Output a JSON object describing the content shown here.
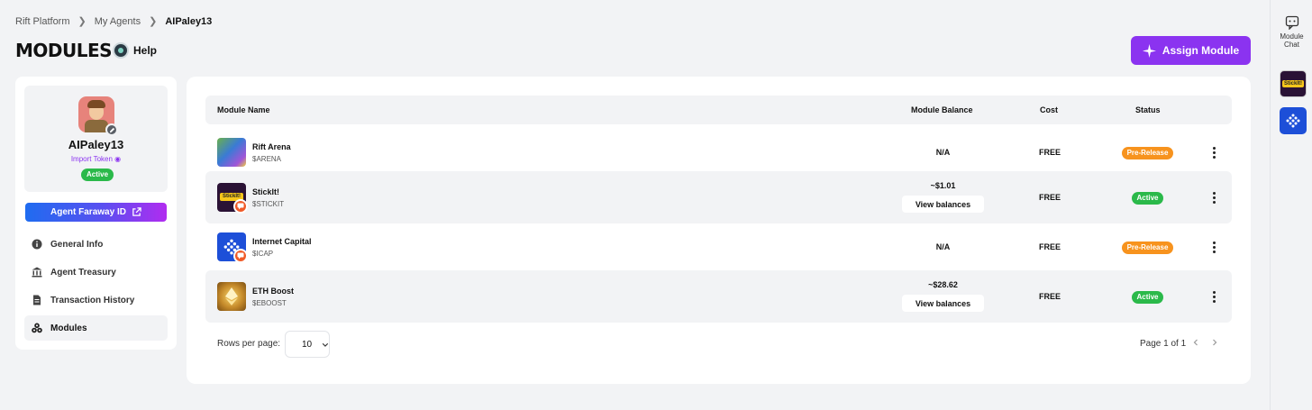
{
  "breadcrumb": {
    "items": [
      "Rift Platform",
      "My Agents"
    ],
    "current": "AIPaley13"
  },
  "page": {
    "title": "MODULES",
    "help_label": "Help"
  },
  "toolbar": {
    "assign_label": "Assign Module"
  },
  "right_rail": {
    "chat_label_1": "Module",
    "chat_label_2": "Chat",
    "apps": [
      "StickIt!",
      "Internet Capital"
    ]
  },
  "profile": {
    "name": "AIPaley13",
    "import_label": "Import Token",
    "status": "Active"
  },
  "faraway_button": "Agent Faraway ID",
  "nav": {
    "items": [
      {
        "label": "General Info",
        "icon": "info-icon"
      },
      {
        "label": "Agent Treasury",
        "icon": "bank-icon"
      },
      {
        "label": "Transaction History",
        "icon": "document-icon"
      },
      {
        "label": "Modules",
        "icon": "modules-icon"
      }
    ],
    "selected": "Modules"
  },
  "table": {
    "headers": {
      "name": "Module Name",
      "balance": "Module Balance",
      "cost": "Cost",
      "status": "Status"
    },
    "rows": [
      {
        "name": "Rift Arena",
        "ticker": "$ARENA",
        "balance": "N/A",
        "view": "",
        "cost": "FREE",
        "status": "Pre-Release"
      },
      {
        "name": "StickIt!",
        "ticker": "$STICKIT",
        "balance": "~$1.01",
        "view": "View balances",
        "cost": "FREE",
        "status": "Active"
      },
      {
        "name": "Internet Capital",
        "ticker": "$ICAP",
        "balance": "N/A",
        "view": "",
        "cost": "FREE",
        "status": "Pre-Release"
      },
      {
        "name": "ETH Boost",
        "ticker": "$EBOOST",
        "balance": "~$28.62",
        "view": "View balances",
        "cost": "FREE",
        "status": "Active"
      }
    ]
  },
  "pagination": {
    "rows_label": "Rows per page:",
    "rows_value": "10",
    "page_info": "Page 1 of 1"
  },
  "colors": {
    "accent": "#8b33f0",
    "active": "#2bb94a",
    "pre_release": "#f7931e",
    "badge": "#f05a28"
  }
}
